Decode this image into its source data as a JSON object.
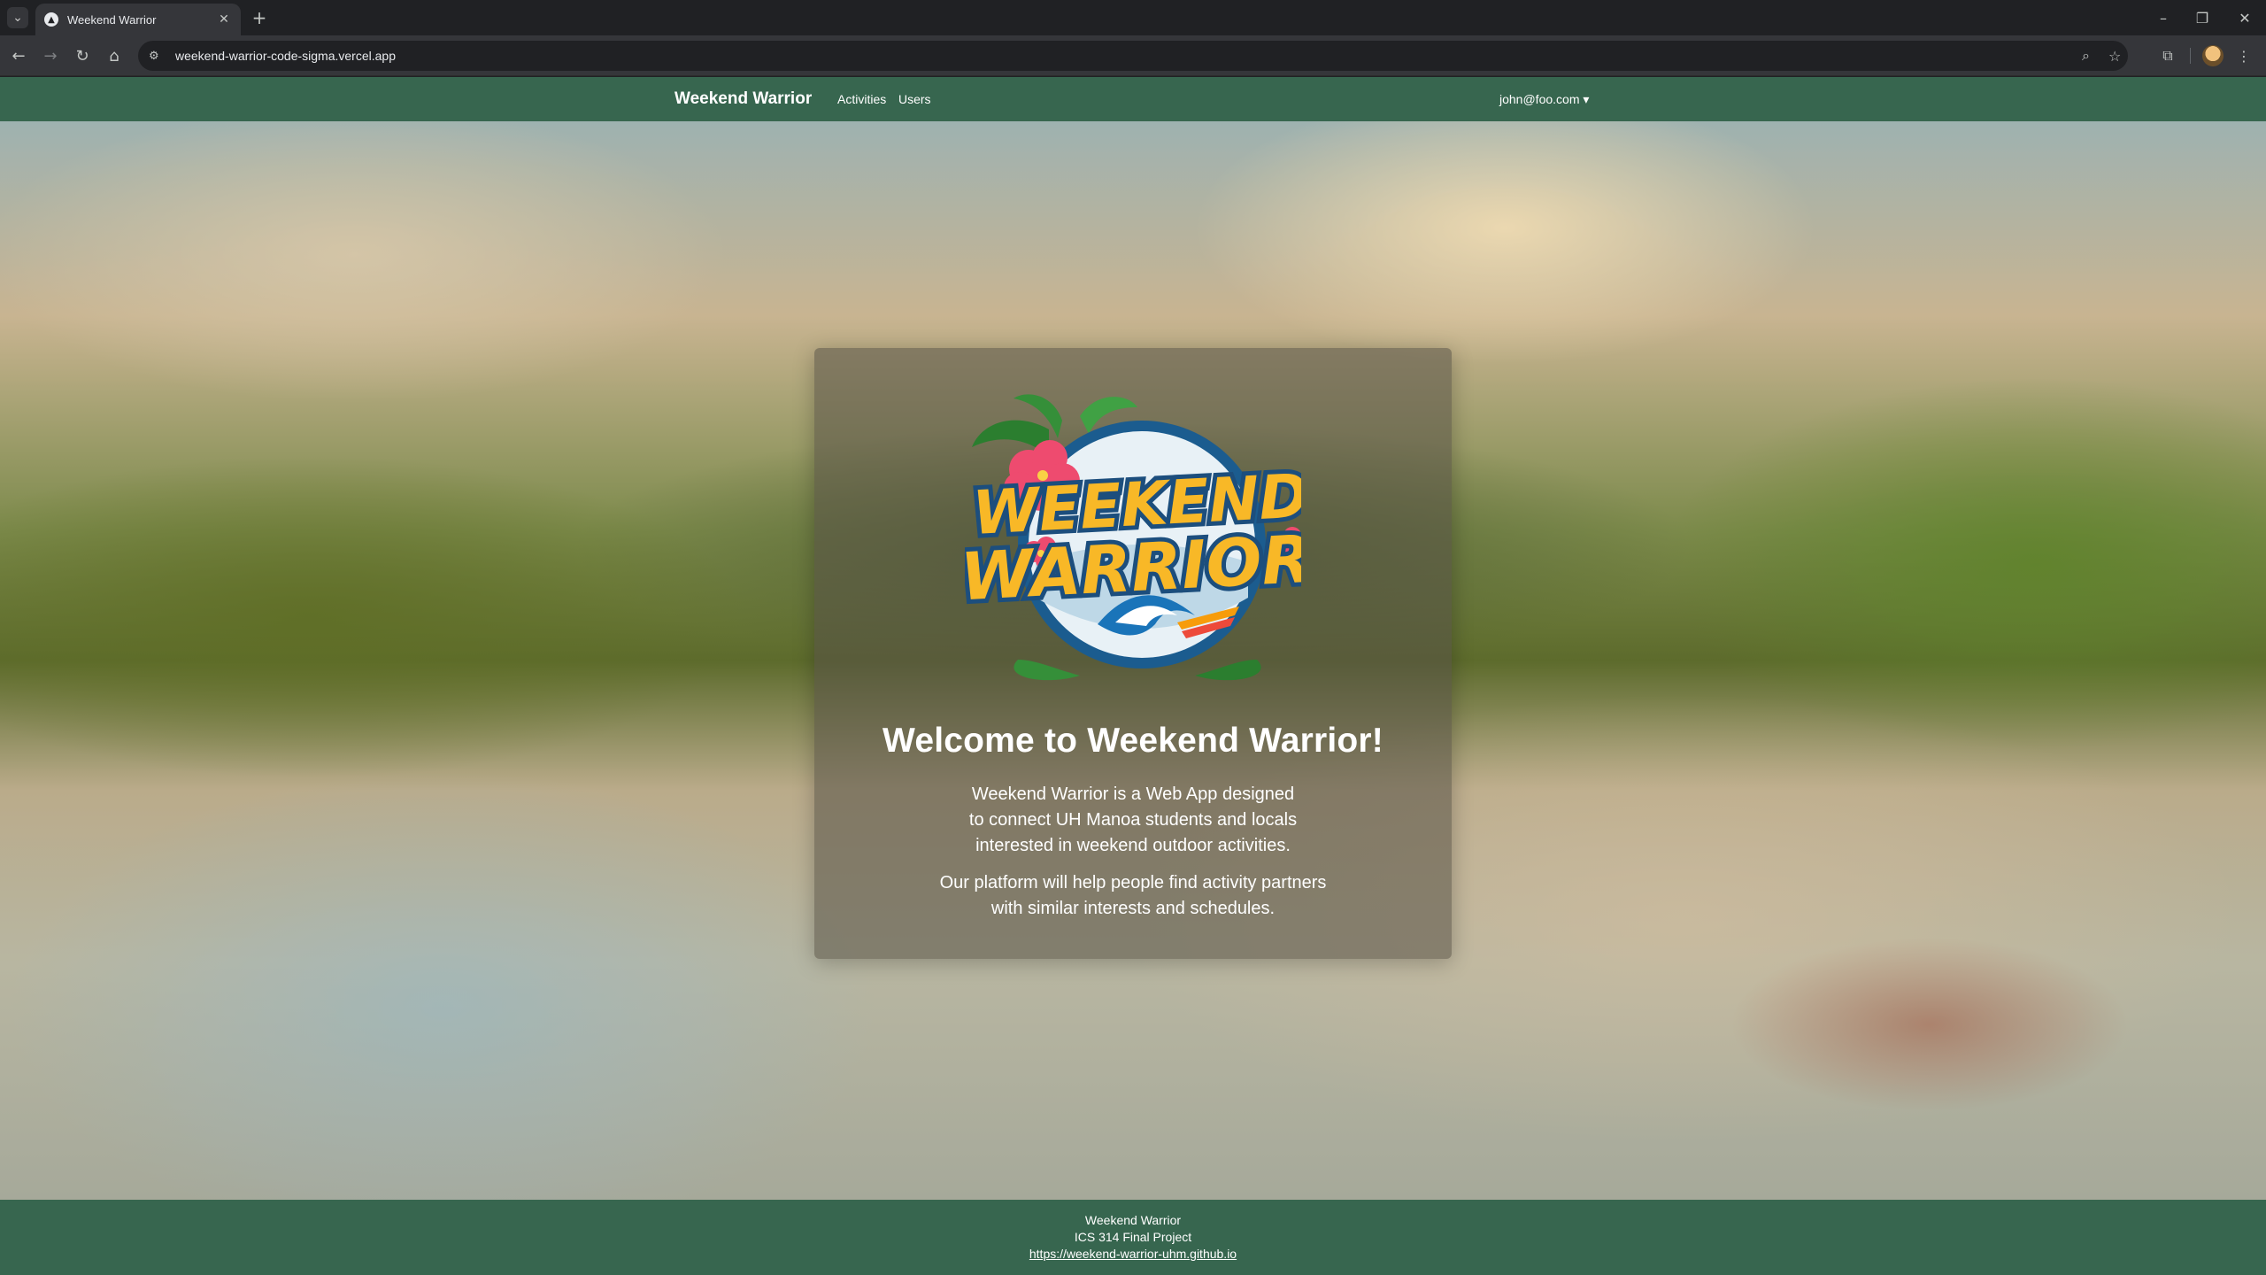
{
  "browser": {
    "tab_title": "Weekend Warrior",
    "url": "weekend-warrior-code-sigma.vercel.app"
  },
  "navbar": {
    "brand": "Weekend Warrior",
    "links": [
      "Activities",
      "Users"
    ],
    "user": "john@foo.com ▾"
  },
  "hero": {
    "logo_text": [
      "WEEKEND",
      "WARRIOR"
    ],
    "title": "Welcome to Weekend Warrior!",
    "paragraph1": [
      "Weekend Warrior is a Web App designed",
      "to connect UH Manoa students and locals",
      "interested in weekend outdoor activities."
    ],
    "paragraph2": [
      "Our platform will help people find activity partners",
      "with similar interests and schedules."
    ]
  },
  "footer": {
    "name": "Weekend Warrior",
    "course": "ICS 314 Final Project",
    "link": "https://weekend-warrior-uhm.github.io"
  },
  "colors": {
    "nav_green": "#37664f",
    "logo_yellow": "#f5b82e",
    "logo_blue": "#1e5c8c"
  }
}
